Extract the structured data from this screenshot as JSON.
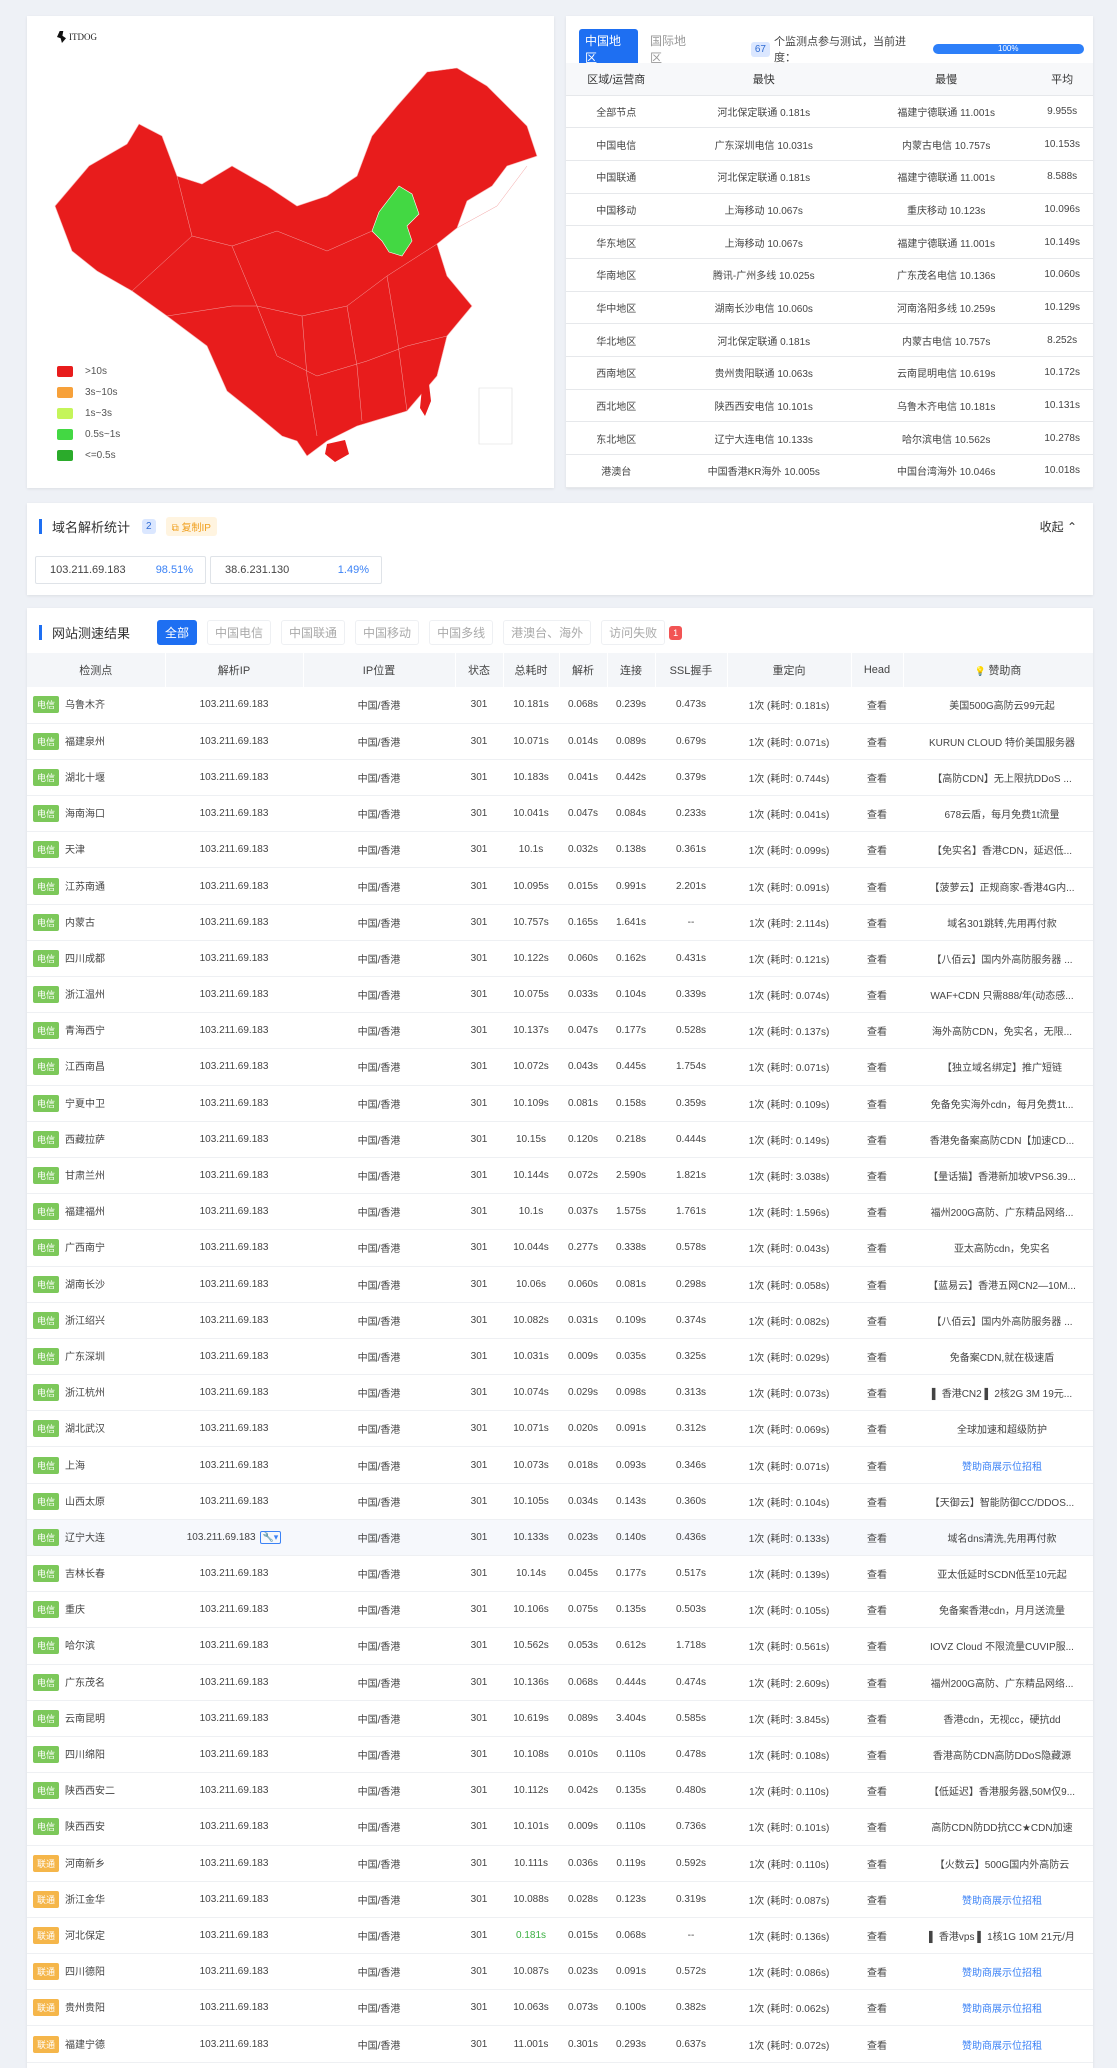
{
  "map": {
    "logo_text": "ITDOG",
    "legend": [
      {
        "label": ">10s",
        "color": "#e81c1c"
      },
      {
        "label": "3s~10s",
        "color": "#f7a13a"
      },
      {
        "label": "1s~3s",
        "color": "#c5f55a"
      },
      {
        "label": "0.5s~1s",
        "color": "#43d843"
      },
      {
        "label": "<=0.5s",
        "color": "#2bab2b"
      }
    ],
    "colors": {
      "main": "#e81c1c",
      "fast": "#43d843",
      "border": "#ffffff"
    }
  },
  "summary": {
    "tab_china": "中国地区",
    "tab_intl": "国际地区",
    "count": "67",
    "count_text": "个监测点参与测试，当前进度：",
    "progress": "100%",
    "headers": [
      "区域/运营商",
      "最快",
      "最慢",
      "平均"
    ],
    "rows": [
      [
        "全部节点",
        "河北保定联通 0.181s",
        "福建宁德联通 11.001s",
        "9.955s"
      ],
      [
        "中国电信",
        "广东深圳电信 10.031s",
        "内蒙古电信 10.757s",
        "10.153s"
      ],
      [
        "中国联通",
        "河北保定联通 0.181s",
        "福建宁德联通 11.001s",
        "8.588s"
      ],
      [
        "中国移动",
        "上海移动 10.067s",
        "重庆移动 10.123s",
        "10.096s"
      ],
      [
        "华东地区",
        "上海移动 10.067s",
        "福建宁德联通 11.001s",
        "10.149s"
      ],
      [
        "华南地区",
        "腾讯-广州多线 10.025s",
        "广东茂名电信 10.136s",
        "10.060s"
      ],
      [
        "华中地区",
        "湖南长沙电信 10.060s",
        "河南洛阳多线 10.259s",
        "10.129s"
      ],
      [
        "华北地区",
        "河北保定联通 0.181s",
        "内蒙古电信 10.757s",
        "8.252s"
      ],
      [
        "西南地区",
        "贵州贵阳联通 10.063s",
        "云南昆明电信 10.619s",
        "10.172s"
      ],
      [
        "西北地区",
        "陕西西安电信 10.101s",
        "乌鲁木齐电信 10.181s",
        "10.131s"
      ],
      [
        "东北地区",
        "辽宁大连电信 10.133s",
        "哈尔滨电信 10.562s",
        "10.278s"
      ],
      [
        "港澳台",
        "中国香港KR海外 10.005s",
        "中国台湾海外 10.046s",
        "10.018s"
      ]
    ]
  },
  "dns": {
    "title": "域名解析统计",
    "count": "2",
    "copy_label": "复制IP",
    "collapse_label": "收起",
    "ips": [
      {
        "ip": "103.211.69.183",
        "pct": "98.51%"
      },
      {
        "ip": "38.6.231.130",
        "pct": "1.49%"
      }
    ]
  },
  "results": {
    "title": "网站测速结果",
    "filters": [
      "全部",
      "中国电信",
      "中国联通",
      "中国移动",
      "中国多线",
      "港澳台、海外",
      "访问失败"
    ],
    "fail_count": "1",
    "headers": [
      "检测点",
      "解析IP",
      "IP位置",
      "状态",
      "总耗时",
      "解析",
      "连接",
      "SSL握手",
      "重定向",
      "Head",
      "赞助商"
    ],
    "head_link": "查看",
    "isp_colors": {
      "电信": "#7cc85a",
      "联通": "#f5b64a"
    },
    "rows": [
      {
        "isp": "电信",
        "node": "乌鲁木齐",
        "ip": "103.211.69.183",
        "loc": "中国/香港",
        "status": "301",
        "total": "10.181s",
        "dns": "0.068s",
        "conn": "0.239s",
        "ssl": "0.473s",
        "redirect": "1次 (耗时: 0.181s)",
        "sponsor": "美国500G高防云99元起"
      },
      {
        "isp": "电信",
        "node": "福建泉州",
        "ip": "103.211.69.183",
        "loc": "中国/香港",
        "status": "301",
        "total": "10.071s",
        "dns": "0.014s",
        "conn": "0.089s",
        "ssl": "0.679s",
        "redirect": "1次 (耗时: 0.071s)",
        "sponsor": "KURUN CLOUD 特价美国服务器"
      },
      {
        "isp": "电信",
        "node": "湖北十堰",
        "ip": "103.211.69.183",
        "loc": "中国/香港",
        "status": "301",
        "total": "10.183s",
        "dns": "0.041s",
        "conn": "0.442s",
        "ssl": "0.379s",
        "redirect": "1次 (耗时: 0.744s)",
        "sponsor": "【高防CDN】无上限抗DDoS ..."
      },
      {
        "isp": "电信",
        "node": "海南海口",
        "ip": "103.211.69.183",
        "loc": "中国/香港",
        "status": "301",
        "total": "10.041s",
        "dns": "0.047s",
        "conn": "0.084s",
        "ssl": "0.233s",
        "redirect": "1次 (耗时: 0.041s)",
        "sponsor": "678云盾，每月免费1t流量"
      },
      {
        "isp": "电信",
        "node": "天津",
        "ip": "103.211.69.183",
        "loc": "中国/香港",
        "status": "301",
        "total": "10.1s",
        "dns": "0.032s",
        "conn": "0.138s",
        "ssl": "0.361s",
        "redirect": "1次 (耗时: 0.099s)",
        "sponsor": "【免实名】香港CDN，延迟低..."
      },
      {
        "isp": "电信",
        "node": "江苏南通",
        "ip": "103.211.69.183",
        "loc": "中国/香港",
        "status": "301",
        "total": "10.095s",
        "dns": "0.015s",
        "conn": "0.991s",
        "ssl": "2.201s",
        "redirect": "1次 (耗时: 0.091s)",
        "sponsor": "【菠萝云】正规商家-香港4G内..."
      },
      {
        "isp": "电信",
        "node": "内蒙古",
        "ip": "103.211.69.183",
        "loc": "中国/香港",
        "status": "301",
        "total": "10.757s",
        "dns": "0.165s",
        "conn": "1.641s",
        "ssl": "--",
        "redirect": "1次 (耗时: 2.114s)",
        "sponsor": "域名301跳转,先用再付款"
      },
      {
        "isp": "电信",
        "node": "四川成都",
        "ip": "103.211.69.183",
        "loc": "中国/香港",
        "status": "301",
        "total": "10.122s",
        "dns": "0.060s",
        "conn": "0.162s",
        "ssl": "0.431s",
        "redirect": "1次 (耗时: 0.121s)",
        "sponsor": "【八佰云】国内外高防服务器 ..."
      },
      {
        "isp": "电信",
        "node": "浙江温州",
        "ip": "103.211.69.183",
        "loc": "中国/香港",
        "status": "301",
        "total": "10.075s",
        "dns": "0.033s",
        "conn": "0.104s",
        "ssl": "0.339s",
        "redirect": "1次 (耗时: 0.074s)",
        "sponsor": "WAF+CDN 只需888/年(动态感..."
      },
      {
        "isp": "电信",
        "node": "青海西宁",
        "ip": "103.211.69.183",
        "loc": "中国/香港",
        "status": "301",
        "total": "10.137s",
        "dns": "0.047s",
        "conn": "0.177s",
        "ssl": "0.528s",
        "redirect": "1次 (耗时: 0.137s)",
        "sponsor": "海外高防CDN，免实名，无限..."
      },
      {
        "isp": "电信",
        "node": "江西南昌",
        "ip": "103.211.69.183",
        "loc": "中国/香港",
        "status": "301",
        "total": "10.072s",
        "dns": "0.043s",
        "conn": "0.445s",
        "ssl": "1.754s",
        "redirect": "1次 (耗时: 0.071s)",
        "sponsor": "【独立域名绑定】推广短链"
      },
      {
        "isp": "电信",
        "node": "宁夏中卫",
        "ip": "103.211.69.183",
        "loc": "中国/香港",
        "status": "301",
        "total": "10.109s",
        "dns": "0.081s",
        "conn": "0.158s",
        "ssl": "0.359s",
        "redirect": "1次 (耗时: 0.109s)",
        "sponsor": "免备免实海外cdn，每月免费1t..."
      },
      {
        "isp": "电信",
        "node": "西藏拉萨",
        "ip": "103.211.69.183",
        "loc": "中国/香港",
        "status": "301",
        "total": "10.15s",
        "dns": "0.120s",
        "conn": "0.218s",
        "ssl": "0.444s",
        "redirect": "1次 (耗时: 0.149s)",
        "sponsor": "香港免备案高防CDN【加速CD..."
      },
      {
        "isp": "电信",
        "node": "甘肃兰州",
        "ip": "103.211.69.183",
        "loc": "中国/香港",
        "status": "301",
        "total": "10.144s",
        "dns": "0.072s",
        "conn": "2.590s",
        "ssl": "1.821s",
        "redirect": "1次 (耗时: 3.038s)",
        "sponsor": "【量话猫】香港新加坡VPS6.39..."
      },
      {
        "isp": "电信",
        "node": "福建福州",
        "ip": "103.211.69.183",
        "loc": "中国/香港",
        "status": "301",
        "total": "10.1s",
        "dns": "0.037s",
        "conn": "1.575s",
        "ssl": "1.761s",
        "redirect": "1次 (耗时: 1.596s)",
        "sponsor": "福州200G高防、广东精品网络..."
      },
      {
        "isp": "电信",
        "node": "广西南宁",
        "ip": "103.211.69.183",
        "loc": "中国/香港",
        "status": "301",
        "total": "10.044s",
        "dns": "0.277s",
        "conn": "0.338s",
        "ssl": "0.578s",
        "redirect": "1次 (耗时: 0.043s)",
        "sponsor": "亚太高防cdn，免实名"
      },
      {
        "isp": "电信",
        "node": "湖南长沙",
        "ip": "103.211.69.183",
        "loc": "中国/香港",
        "status": "301",
        "total": "10.06s",
        "dns": "0.060s",
        "conn": "0.081s",
        "ssl": "0.298s",
        "redirect": "1次 (耗时: 0.058s)",
        "sponsor": "【蓝易云】香港五网CN2—10M..."
      },
      {
        "isp": "电信",
        "node": "浙江绍兴",
        "ip": "103.211.69.183",
        "loc": "中国/香港",
        "status": "301",
        "total": "10.082s",
        "dns": "0.031s",
        "conn": "0.109s",
        "ssl": "0.374s",
        "redirect": "1次 (耗时: 0.082s)",
        "sponsor": "【八佰云】国内外高防服务器 ..."
      },
      {
        "isp": "电信",
        "node": "广东深圳",
        "ip": "103.211.69.183",
        "loc": "中国/香港",
        "status": "301",
        "total": "10.031s",
        "dns": "0.009s",
        "conn": "0.035s",
        "ssl": "0.325s",
        "redirect": "1次 (耗时: 0.029s)",
        "sponsor": "免备案CDN,就在极速盾"
      },
      {
        "isp": "电信",
        "node": "浙江杭州",
        "ip": "103.211.69.183",
        "loc": "中国/香港",
        "status": "301",
        "total": "10.074s",
        "dns": "0.029s",
        "conn": "0.098s",
        "ssl": "0.313s",
        "redirect": "1次 (耗时: 0.073s)",
        "sponsor": "▌ 香港CN2 ▌ 2核2G 3M 19元..."
      },
      {
        "isp": "电信",
        "node": "湖北武汉",
        "ip": "103.211.69.183",
        "loc": "中国/香港",
        "status": "301",
        "total": "10.071s",
        "dns": "0.020s",
        "conn": "0.091s",
        "ssl": "0.312s",
        "redirect": "1次 (耗时: 0.069s)",
        "sponsor": "全球加速和超级防护"
      },
      {
        "isp": "电信",
        "node": "上海",
        "ip": "103.211.69.183",
        "loc": "中国/香港",
        "status": "301",
        "total": "10.073s",
        "dns": "0.018s",
        "conn": "0.093s",
        "ssl": "0.346s",
        "redirect": "1次 (耗时: 0.071s)",
        "sponsor": "赞助商展示位招租",
        "link": true
      },
      {
        "isp": "电信",
        "node": "山西太原",
        "ip": "103.211.69.183",
        "loc": "中国/香港",
        "status": "301",
        "total": "10.105s",
        "dns": "0.034s",
        "conn": "0.143s",
        "ssl": "0.360s",
        "redirect": "1次 (耗时: 0.104s)",
        "sponsor": "【天御云】智能防御CC/DDOS..."
      },
      {
        "isp": "电信",
        "node": "辽宁大连",
        "ip": "103.211.69.183",
        "loc": "中国/香港",
        "status": "301",
        "total": "10.133s",
        "dns": "0.023s",
        "conn": "0.140s",
        "ssl": "0.436s",
        "redirect": "1次 (耗时: 0.133s)",
        "sponsor": "域名dns清洗,先用再付款",
        "hl": true
      },
      {
        "isp": "电信",
        "node": "吉林长春",
        "ip": "103.211.69.183",
        "loc": "中国/香港",
        "status": "301",
        "total": "10.14s",
        "dns": "0.045s",
        "conn": "0.177s",
        "ssl": "0.517s",
        "redirect": "1次 (耗时: 0.139s)",
        "sponsor": "亚太低延时SCDN低至10元起"
      },
      {
        "isp": "电信",
        "node": "重庆",
        "ip": "103.211.69.183",
        "loc": "中国/香港",
        "status": "301",
        "total": "10.106s",
        "dns": "0.075s",
        "conn": "0.135s",
        "ssl": "0.503s",
        "redirect": "1次 (耗时: 0.105s)",
        "sponsor": "免备案香港cdn，月月送流量"
      },
      {
        "isp": "电信",
        "node": "哈尔滨",
        "ip": "103.211.69.183",
        "loc": "中国/香港",
        "status": "301",
        "total": "10.562s",
        "dns": "0.053s",
        "conn": "0.612s",
        "ssl": "1.718s",
        "redirect": "1次 (耗时: 0.561s)",
        "sponsor": "IOVZ Cloud 不限流量CUVIP服..."
      },
      {
        "isp": "电信",
        "node": "广东茂名",
        "ip": "103.211.69.183",
        "loc": "中国/香港",
        "status": "301",
        "total": "10.136s",
        "dns": "0.068s",
        "conn": "0.444s",
        "ssl": "0.474s",
        "redirect": "1次 (耗时: 2.609s)",
        "sponsor": "福州200G高防、广东精品网络..."
      },
      {
        "isp": "电信",
        "node": "云南昆明",
        "ip": "103.211.69.183",
        "loc": "中国/香港",
        "status": "301",
        "total": "10.619s",
        "dns": "0.089s",
        "conn": "3.404s",
        "ssl": "0.585s",
        "redirect": "1次 (耗时: 3.845s)",
        "sponsor": "香港cdn，无视cc，硬抗dd"
      },
      {
        "isp": "电信",
        "node": "四川绵阳",
        "ip": "103.211.69.183",
        "loc": "中国/香港",
        "status": "301",
        "total": "10.108s",
        "dns": "0.010s",
        "conn": "0.110s",
        "ssl": "0.478s",
        "redirect": "1次 (耗时: 0.108s)",
        "sponsor": "香港高防CDN高防DDoS隐藏源"
      },
      {
        "isp": "电信",
        "node": "陕西西安二",
        "ip": "103.211.69.183",
        "loc": "中国/香港",
        "status": "301",
        "total": "10.112s",
        "dns": "0.042s",
        "conn": "0.135s",
        "ssl": "0.480s",
        "redirect": "1次 (耗时: 0.110s)",
        "sponsor": "【低延迟】香港服务器,50M仅9..."
      },
      {
        "isp": "电信",
        "node": "陕西西安",
        "ip": "103.211.69.183",
        "loc": "中国/香港",
        "status": "301",
        "total": "10.101s",
        "dns": "0.009s",
        "conn": "0.110s",
        "ssl": "0.736s",
        "redirect": "1次 (耗时: 0.101s)",
        "sponsor": "高防CDN防DD抗CC★CDN加速"
      },
      {
        "isp": "联通",
        "node": "河南新乡",
        "ip": "103.211.69.183",
        "loc": "中国/香港",
        "status": "301",
        "total": "10.111s",
        "dns": "0.036s",
        "conn": "0.119s",
        "ssl": "0.592s",
        "redirect": "1次 (耗时: 0.110s)",
        "sponsor": "【火数云】500G国内外高防云"
      },
      {
        "isp": "联通",
        "node": "浙江金华",
        "ip": "103.211.69.183",
        "loc": "中国/香港",
        "status": "301",
        "total": "10.088s",
        "dns": "0.028s",
        "conn": "0.123s",
        "ssl": "0.319s",
        "redirect": "1次 (耗时: 0.087s)",
        "sponsor": "赞助商展示位招租",
        "link": true
      },
      {
        "isp": "联通",
        "node": "河北保定",
        "ip": "103.211.69.183",
        "loc": "中国/香港",
        "status": "301",
        "total": "0.181s",
        "dns": "0.015s",
        "conn": "0.068s",
        "ssl": "--",
        "redirect": "1次 (耗时: 0.136s)",
        "sponsor": "▌ 香港vps ▌ 1核1G 10M 21元/月",
        "good": true
      },
      {
        "isp": "联通",
        "node": "四川德阳",
        "ip": "103.211.69.183",
        "loc": "中国/香港",
        "status": "301",
        "total": "10.087s",
        "dns": "0.023s",
        "conn": "0.091s",
        "ssl": "0.572s",
        "redirect": "1次 (耗时: 0.086s)",
        "sponsor": "赞助商展示位招租",
        "link": true
      },
      {
        "isp": "联通",
        "node": "贵州贵阳",
        "ip": "103.211.69.183",
        "loc": "中国/香港",
        "status": "301",
        "total": "10.063s",
        "dns": "0.073s",
        "conn": "0.100s",
        "ssl": "0.382s",
        "redirect": "1次 (耗时: 0.062s)",
        "sponsor": "赞助商展示位招租",
        "link": true
      },
      {
        "isp": "联通",
        "node": "福建宁德",
        "ip": "103.211.69.183",
        "loc": "中国/香港",
        "status": "301",
        "total": "11.001s",
        "dns": "0.301s",
        "conn": "0.293s",
        "ssl": "0.637s",
        "redirect": "1次 (耗时: 0.072s)",
        "sponsor": "赞助商展示位招租",
        "link": true
      }
    ]
  }
}
